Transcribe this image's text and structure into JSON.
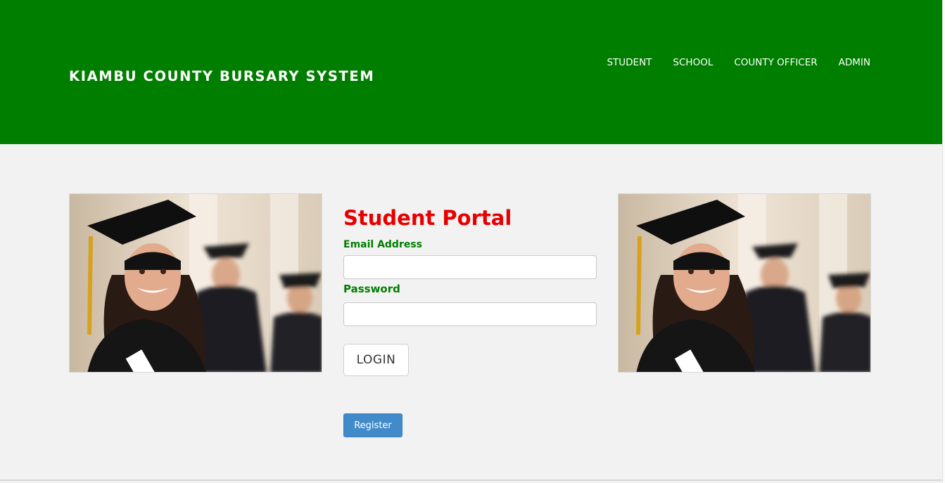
{
  "header": {
    "brand": "KIAMBU COUNTY BURSARY SYSTEM",
    "nav": [
      "STUDENT",
      "SCHOOL",
      "COUNTY OFFICER",
      "ADMIN"
    ]
  },
  "form": {
    "title": "Student Portal",
    "email_label": "Email Address",
    "email_value": "",
    "password_label": "Password",
    "password_value": "",
    "login_label": "LOGIN",
    "register_label": "Register"
  },
  "colors": {
    "header_bg": "#007e00",
    "title": "#e60000",
    "label": "#007e00",
    "register_bg": "#428bca",
    "page_bg": "#f2f2f2"
  },
  "images": {
    "left_photo": "graduate-photo",
    "right_photo": "graduate-photo"
  }
}
